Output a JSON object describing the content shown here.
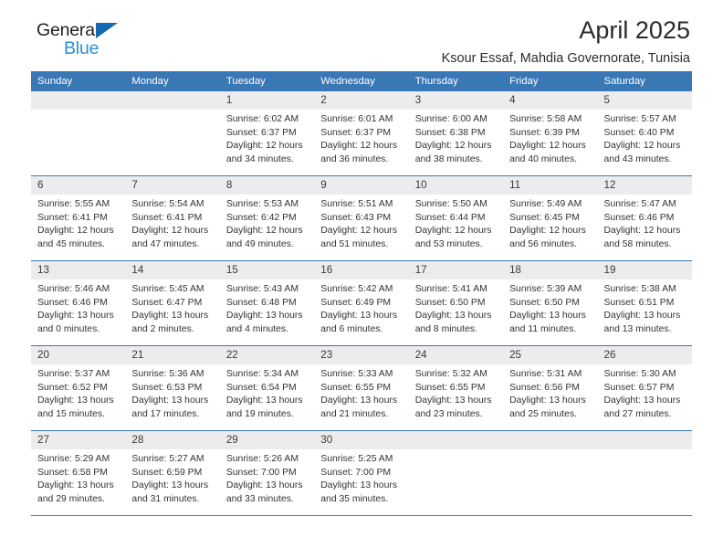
{
  "brand": {
    "name_part1": "General",
    "name_part2": "Blue",
    "triangle_color": "#1669b0",
    "blue_color": "#2a8fd4"
  },
  "header": {
    "title": "April 2025",
    "subtitle": "Ksour Essaf, Mahdia Governorate, Tunisia",
    "accent_color": "#3a77b5",
    "daynum_band_color": "#ececec"
  },
  "calendar": {
    "weekday_headers": [
      "Sunday",
      "Monday",
      "Tuesday",
      "Wednesday",
      "Thursday",
      "Friday",
      "Saturday"
    ],
    "weeks": [
      [
        {
          "date": "",
          "sunrise": "",
          "sunset": "",
          "daylight1": "",
          "daylight2": ""
        },
        {
          "date": "",
          "sunrise": "",
          "sunset": "",
          "daylight1": "",
          "daylight2": ""
        },
        {
          "date": "1",
          "sunrise": "Sunrise: 6:02 AM",
          "sunset": "Sunset: 6:37 PM",
          "daylight1": "Daylight: 12 hours",
          "daylight2": "and 34 minutes."
        },
        {
          "date": "2",
          "sunrise": "Sunrise: 6:01 AM",
          "sunset": "Sunset: 6:37 PM",
          "daylight1": "Daylight: 12 hours",
          "daylight2": "and 36 minutes."
        },
        {
          "date": "3",
          "sunrise": "Sunrise: 6:00 AM",
          "sunset": "Sunset: 6:38 PM",
          "daylight1": "Daylight: 12 hours",
          "daylight2": "and 38 minutes."
        },
        {
          "date": "4",
          "sunrise": "Sunrise: 5:58 AM",
          "sunset": "Sunset: 6:39 PM",
          "daylight1": "Daylight: 12 hours",
          "daylight2": "and 40 minutes."
        },
        {
          "date": "5",
          "sunrise": "Sunrise: 5:57 AM",
          "sunset": "Sunset: 6:40 PM",
          "daylight1": "Daylight: 12 hours",
          "daylight2": "and 43 minutes."
        }
      ],
      [
        {
          "date": "6",
          "sunrise": "Sunrise: 5:55 AM",
          "sunset": "Sunset: 6:41 PM",
          "daylight1": "Daylight: 12 hours",
          "daylight2": "and 45 minutes."
        },
        {
          "date": "7",
          "sunrise": "Sunrise: 5:54 AM",
          "sunset": "Sunset: 6:41 PM",
          "daylight1": "Daylight: 12 hours",
          "daylight2": "and 47 minutes."
        },
        {
          "date": "8",
          "sunrise": "Sunrise: 5:53 AM",
          "sunset": "Sunset: 6:42 PM",
          "daylight1": "Daylight: 12 hours",
          "daylight2": "and 49 minutes."
        },
        {
          "date": "9",
          "sunrise": "Sunrise: 5:51 AM",
          "sunset": "Sunset: 6:43 PM",
          "daylight1": "Daylight: 12 hours",
          "daylight2": "and 51 minutes."
        },
        {
          "date": "10",
          "sunrise": "Sunrise: 5:50 AM",
          "sunset": "Sunset: 6:44 PM",
          "daylight1": "Daylight: 12 hours",
          "daylight2": "and 53 minutes."
        },
        {
          "date": "11",
          "sunrise": "Sunrise: 5:49 AM",
          "sunset": "Sunset: 6:45 PM",
          "daylight1": "Daylight: 12 hours",
          "daylight2": "and 56 minutes."
        },
        {
          "date": "12",
          "sunrise": "Sunrise: 5:47 AM",
          "sunset": "Sunset: 6:46 PM",
          "daylight1": "Daylight: 12 hours",
          "daylight2": "and 58 minutes."
        }
      ],
      [
        {
          "date": "13",
          "sunrise": "Sunrise: 5:46 AM",
          "sunset": "Sunset: 6:46 PM",
          "daylight1": "Daylight: 13 hours",
          "daylight2": "and 0 minutes."
        },
        {
          "date": "14",
          "sunrise": "Sunrise: 5:45 AM",
          "sunset": "Sunset: 6:47 PM",
          "daylight1": "Daylight: 13 hours",
          "daylight2": "and 2 minutes."
        },
        {
          "date": "15",
          "sunrise": "Sunrise: 5:43 AM",
          "sunset": "Sunset: 6:48 PM",
          "daylight1": "Daylight: 13 hours",
          "daylight2": "and 4 minutes."
        },
        {
          "date": "16",
          "sunrise": "Sunrise: 5:42 AM",
          "sunset": "Sunset: 6:49 PM",
          "daylight1": "Daylight: 13 hours",
          "daylight2": "and 6 minutes."
        },
        {
          "date": "17",
          "sunrise": "Sunrise: 5:41 AM",
          "sunset": "Sunset: 6:50 PM",
          "daylight1": "Daylight: 13 hours",
          "daylight2": "and 8 minutes."
        },
        {
          "date": "18",
          "sunrise": "Sunrise: 5:39 AM",
          "sunset": "Sunset: 6:50 PM",
          "daylight1": "Daylight: 13 hours",
          "daylight2": "and 11 minutes."
        },
        {
          "date": "19",
          "sunrise": "Sunrise: 5:38 AM",
          "sunset": "Sunset: 6:51 PM",
          "daylight1": "Daylight: 13 hours",
          "daylight2": "and 13 minutes."
        }
      ],
      [
        {
          "date": "20",
          "sunrise": "Sunrise: 5:37 AM",
          "sunset": "Sunset: 6:52 PM",
          "daylight1": "Daylight: 13 hours",
          "daylight2": "and 15 minutes."
        },
        {
          "date": "21",
          "sunrise": "Sunrise: 5:36 AM",
          "sunset": "Sunset: 6:53 PM",
          "daylight1": "Daylight: 13 hours",
          "daylight2": "and 17 minutes."
        },
        {
          "date": "22",
          "sunrise": "Sunrise: 5:34 AM",
          "sunset": "Sunset: 6:54 PM",
          "daylight1": "Daylight: 13 hours",
          "daylight2": "and 19 minutes."
        },
        {
          "date": "23",
          "sunrise": "Sunrise: 5:33 AM",
          "sunset": "Sunset: 6:55 PM",
          "daylight1": "Daylight: 13 hours",
          "daylight2": "and 21 minutes."
        },
        {
          "date": "24",
          "sunrise": "Sunrise: 5:32 AM",
          "sunset": "Sunset: 6:55 PM",
          "daylight1": "Daylight: 13 hours",
          "daylight2": "and 23 minutes."
        },
        {
          "date": "25",
          "sunrise": "Sunrise: 5:31 AM",
          "sunset": "Sunset: 6:56 PM",
          "daylight1": "Daylight: 13 hours",
          "daylight2": "and 25 minutes."
        },
        {
          "date": "26",
          "sunrise": "Sunrise: 5:30 AM",
          "sunset": "Sunset: 6:57 PM",
          "daylight1": "Daylight: 13 hours",
          "daylight2": "and 27 minutes."
        }
      ],
      [
        {
          "date": "27",
          "sunrise": "Sunrise: 5:29 AM",
          "sunset": "Sunset: 6:58 PM",
          "daylight1": "Daylight: 13 hours",
          "daylight2": "and 29 minutes."
        },
        {
          "date": "28",
          "sunrise": "Sunrise: 5:27 AM",
          "sunset": "Sunset: 6:59 PM",
          "daylight1": "Daylight: 13 hours",
          "daylight2": "and 31 minutes."
        },
        {
          "date": "29",
          "sunrise": "Sunrise: 5:26 AM",
          "sunset": "Sunset: 7:00 PM",
          "daylight1": "Daylight: 13 hours",
          "daylight2": "and 33 minutes."
        },
        {
          "date": "30",
          "sunrise": "Sunrise: 5:25 AM",
          "sunset": "Sunset: 7:00 PM",
          "daylight1": "Daylight: 13 hours",
          "daylight2": "and 35 minutes."
        },
        {
          "date": "",
          "sunrise": "",
          "sunset": "",
          "daylight1": "",
          "daylight2": ""
        },
        {
          "date": "",
          "sunrise": "",
          "sunset": "",
          "daylight1": "",
          "daylight2": ""
        },
        {
          "date": "",
          "sunrise": "",
          "sunset": "",
          "daylight1": "",
          "daylight2": ""
        }
      ]
    ]
  }
}
